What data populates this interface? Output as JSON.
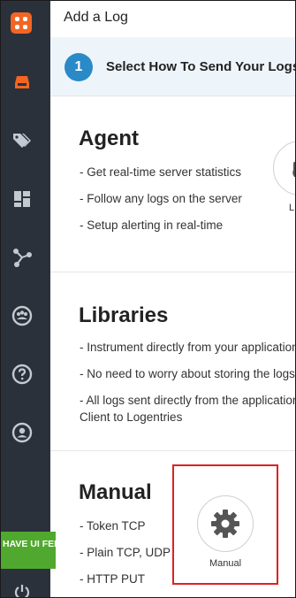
{
  "sidebar": {
    "feedback": "HAVE UI FEEDBACK?",
    "items": [
      {
        "icon": "logo"
      },
      {
        "icon": "inbox-icon"
      },
      {
        "icon": "tags-icon"
      },
      {
        "icon": "dashboard-icon"
      },
      {
        "icon": "graph-icon"
      },
      {
        "icon": "team-icon"
      },
      {
        "icon": "help-icon"
      },
      {
        "icon": "user-icon"
      },
      {
        "icon": "power-icon"
      }
    ]
  },
  "header": {
    "title": "Add a Log"
  },
  "step": {
    "number": "1",
    "text": "Select How To Send Your Logs"
  },
  "agent": {
    "title": "Agent",
    "bullets": [
      "- Get real-time server statistics",
      "- Follow any logs on the server",
      "- Setup alerting in real-time"
    ],
    "option_label_partial": "L"
  },
  "libraries": {
    "title": "Libraries",
    "bullets": [
      "- Instrument directly from your application",
      "- No need to worry about storing the logs",
      "- All logs sent directly from the application",
      "Client to Logentries"
    ]
  },
  "manual": {
    "title": "Manual",
    "bullets": [
      "- Token TCP",
      "- Plain TCP, UDP",
      "- HTTP PUT"
    ],
    "option_label": "Manual"
  },
  "colors": {
    "sidebar": "#2a313b",
    "accent": "#f26522",
    "step": "#2a8ac8",
    "feedback": "#51a82e",
    "highlight": "#e0201f"
  }
}
